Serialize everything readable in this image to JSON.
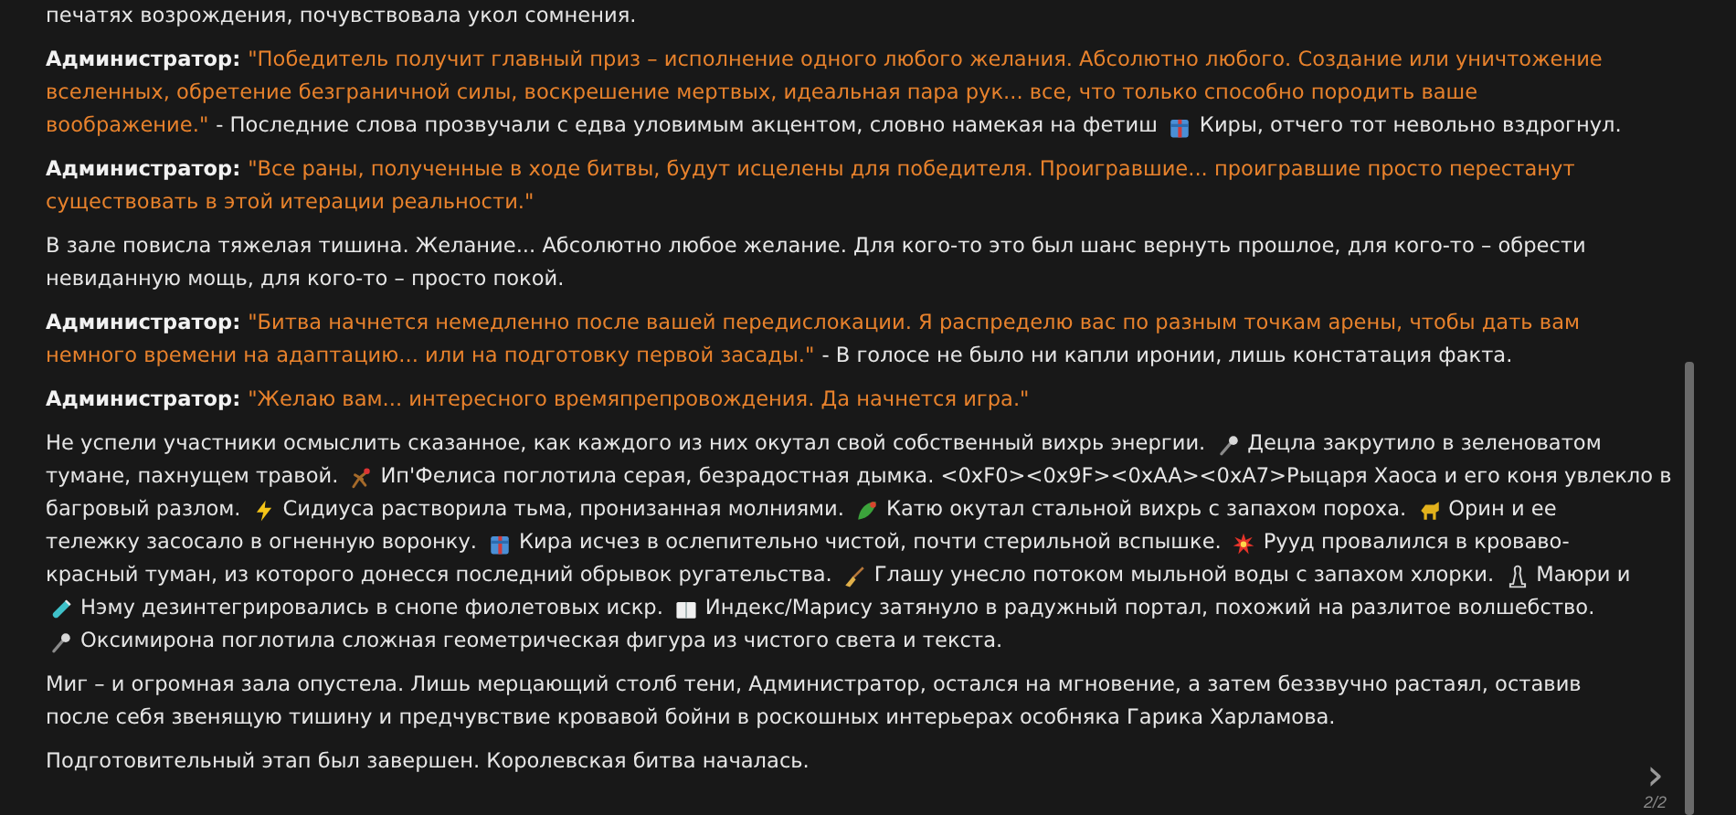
{
  "paragraphs": [
    {
      "lines": [
        [
          {
            "kind": "text",
            "text": "печатях возрождения, почувствовала укол сомнения."
          }
        ]
      ]
    },
    {
      "lines": [
        [
          {
            "kind": "speaker",
            "text": "Администратор:"
          },
          {
            "kind": "quote",
            "text": "\"Победитель получит главный приз – исполнение одного любого желания. Абсолютно любого. Создание или уничтожение"
          }
        ],
        [
          {
            "kind": "quote",
            "text": "вселенных, обретение безграничной силы, воскрешение мертвых, идеальная пара рук... все, что только способно породить ваше"
          }
        ],
        [
          {
            "kind": "quote",
            "text": "воображение.\""
          },
          {
            "kind": "text",
            "text": "- Последние слова прозвучали с едва уловимым акцентом, словно намекая на фетиш"
          },
          {
            "kind": "icon"
          },
          {
            "kind": "text",
            "text": "Киры, отчего тот невольно вздрогнул."
          }
        ]
      ]
    },
    {
      "lines": [
        [
          {
            "kind": "speaker",
            "text": "Администратор:"
          },
          {
            "kind": "quote",
            "text": "\"Все раны, полученные в ходе битвы, будут исцелены для победителя. Проигравшие... проигравшие просто перестанут"
          }
        ],
        [
          {
            "kind": "quote",
            "text": "существовать в этой итерации реальности.\""
          }
        ]
      ]
    },
    {
      "lines": [
        [
          {
            "kind": "text",
            "text": "В зале повисла тяжелая тишина. Желание... Абсолютно любое желание. Для кого-то это был шанс вернуть прошлое, для кого-то – обрести"
          }
        ],
        [
          {
            "kind": "text",
            "text": "невиданную мощь, для кого-то – просто покой."
          }
        ]
      ]
    },
    {
      "lines": [
        [
          {
            "kind": "speaker",
            "text": "Администратор:"
          },
          {
            "kind": "quote",
            "text": "\"Битва начнется немедленно после вашей передислокации. Я распределю вас по разным точкам арены, чтобы дать вам"
          }
        ],
        [
          {
            "kind": "quote",
            "text": "немного времени на адаптацию... или на подготовку первой засады.\""
          },
          {
            "kind": "text",
            "text": "- В голосе не было ни капли иронии, лишь констатация факта."
          }
        ]
      ]
    },
    {
      "lines": [
        [
          {
            "kind": "speaker",
            "text": "Администратор:"
          },
          {
            "kind": "quote",
            "text": "\"Желаю вам... интересного времяпрепровождения. Да начнется игра.\""
          }
        ]
      ]
    },
    {
      "lines": [
        [
          {
            "kind": "text",
            "text": "Не успели участники осмыслить сказанное, как каждого из них окутал свой собственный вихрь энергии."
          },
          {
            "kind": "icon"
          },
          {
            "kind": "text",
            "text": "Децла закрутило в зеленоватом"
          }
        ],
        [
          {
            "kind": "text",
            "text": "тумане, пахнущем травой."
          },
          {
            "kind": "icon"
          },
          {
            "kind": "text",
            "text": "Ип'Фелиса поглотила серая, безрадостная дымка. <0xF0><0x9F><0xAA><0xA7>Рыцаря Хаоса и его коня увлекло в"
          }
        ],
        [
          {
            "kind": "text",
            "text": "багровый разлом."
          },
          {
            "kind": "icon"
          },
          {
            "kind": "text",
            "text": "Сидиуса растворила тьма, пронизанная молниями."
          },
          {
            "kind": "icon"
          },
          {
            "kind": "text",
            "text": "Катю окутал стальной вихрь с запахом пороха."
          },
          {
            "kind": "icon"
          },
          {
            "kind": "text",
            "text": "Орин и ее"
          }
        ],
        [
          {
            "kind": "text",
            "text": "тележку засосало в огненную воронку."
          },
          {
            "kind": "icon"
          },
          {
            "kind": "text",
            "text": "Кира исчез в ослепительно чистой, почти стерильной вспышке."
          },
          {
            "kind": "icon"
          },
          {
            "kind": "text",
            "text": "Рууд провалился в кроваво-"
          }
        ],
        [
          {
            "kind": "text",
            "text": "красный туман, из которого донесся последний обрывок ругательства."
          },
          {
            "kind": "icon"
          },
          {
            "kind": "text",
            "text": "Глашу унесло потоком мыльной воды с запахом хлорки."
          },
          {
            "kind": "icon"
          },
          {
            "kind": "text",
            "text": "Маюри и"
          }
        ],
        [
          {
            "kind": "icon"
          },
          {
            "kind": "text",
            "text": "Нэму дезинтегрировались в снопе фиолетовых искр."
          },
          {
            "kind": "icon"
          },
          {
            "kind": "text",
            "text": "Индекс/Марису затянуло в радужный портал, похожий на разлитое волшебство."
          }
        ],
        [
          {
            "kind": "icon"
          },
          {
            "kind": "text",
            "text": "Оксимирона поглотила сложная геометрическая фигура из чистого света и текста."
          }
        ]
      ]
    },
    {
      "lines": [
        [
          {
            "kind": "text",
            "text": "Миг – и огромная зала опустела. Лишь мерцающий столб тени, Администратор, остался на мгновение, а затем беззвучно растаял, оставив"
          }
        ],
        [
          {
            "kind": "text",
            "text": "после себя звенящую тишину и предчувствие кровавой бойни в роскошных интерьерах особняка Гарика Харламова."
          }
        ]
      ]
    },
    {
      "lines": [
        [
          {
            "kind": "text",
            "text": "Подготовительный этап был завершен. Королевская битва началась."
          }
        ]
      ]
    }
  ],
  "pager": {
    "next": "›",
    "count": "2/2"
  }
}
